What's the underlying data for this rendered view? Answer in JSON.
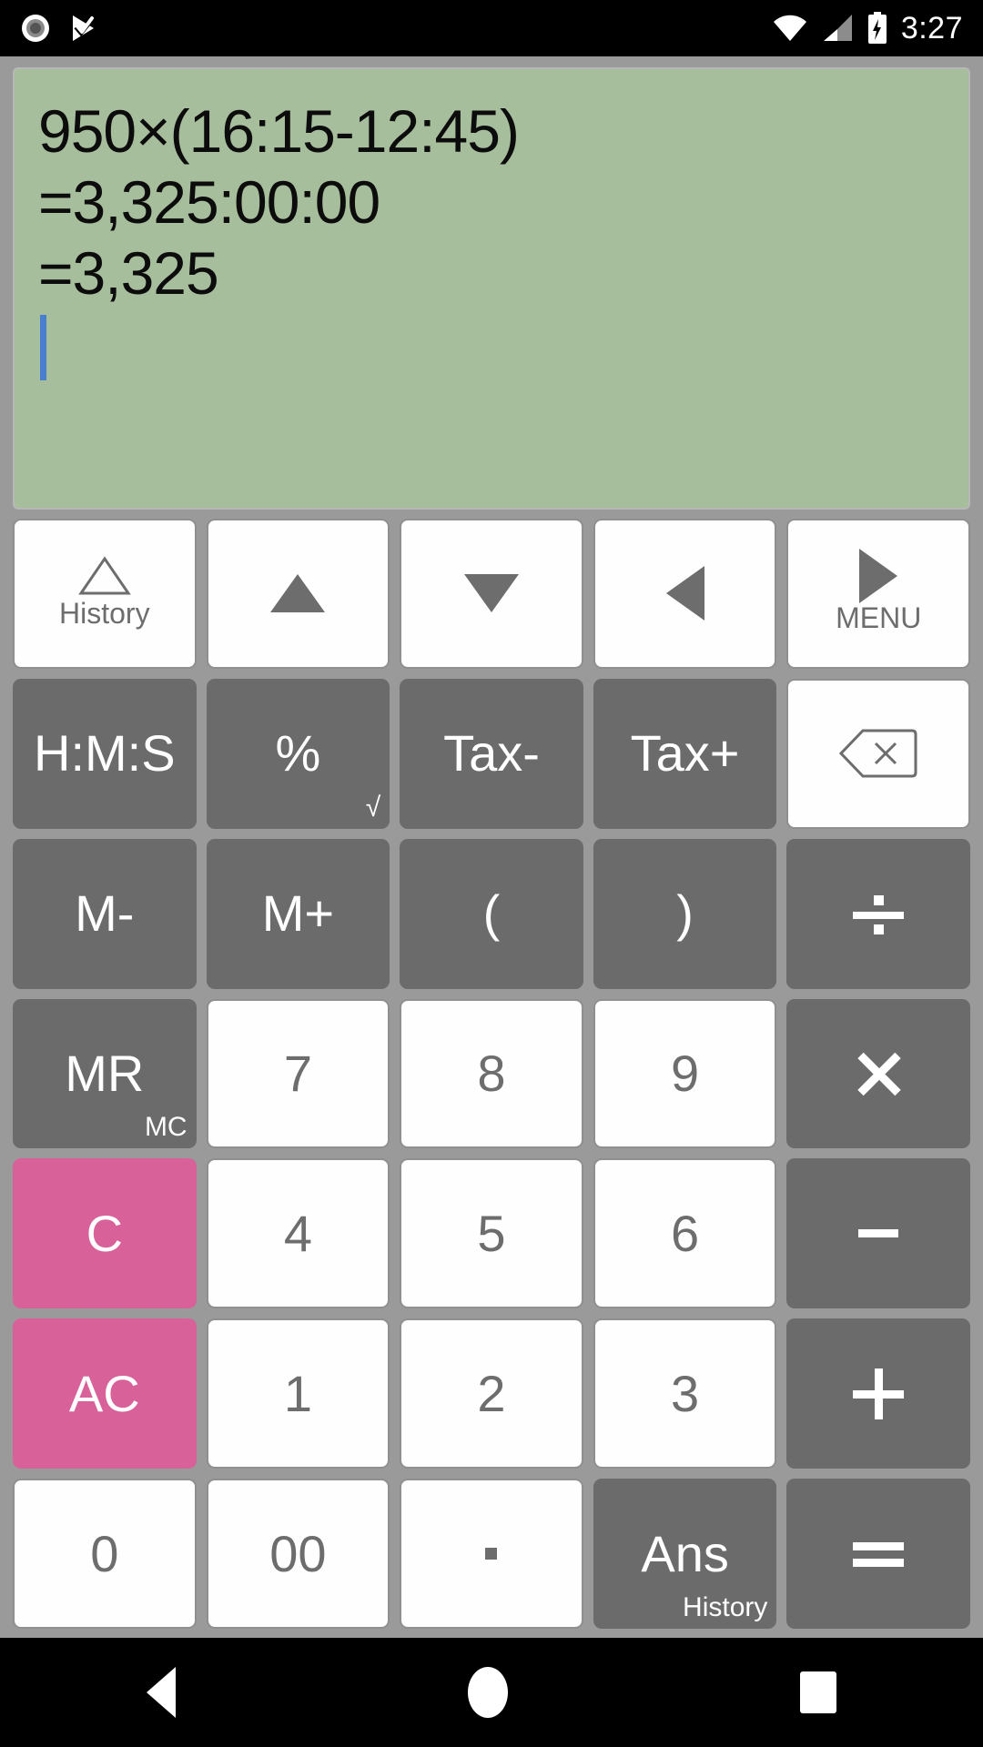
{
  "status_bar": {
    "left_icons": [
      "screen-record-icon",
      "play-check-icon"
    ],
    "right_icons": [
      "wifi-icon",
      "cellular-signal-icon",
      "battery-charging-icon"
    ],
    "time": "3:27"
  },
  "display": {
    "lines": [
      "950×(16:15-12:45)",
      "=3,325:00:00",
      "=3,325"
    ],
    "cursor_visible": true,
    "background_color": "#a7be9d",
    "text_color": "#0c0c0c",
    "cursor_color": "#4a7fd0"
  },
  "colors": {
    "white_key": "#fefefe",
    "gray_key": "#6b6b6b",
    "pink_key": "#d9619a",
    "panel": "#9a9a9a",
    "key_text_dark": "#6d6d6d",
    "key_text_light": "#ffffff"
  },
  "keypad": {
    "row1": [
      {
        "name": "history-key",
        "icon": "triangle-outline-icon",
        "sub": "History"
      },
      {
        "name": "arrow-up-key",
        "icon": "triangle-up-icon"
      },
      {
        "name": "arrow-down-key",
        "icon": "triangle-down-icon"
      },
      {
        "name": "arrow-left-key",
        "icon": "triangle-left-icon"
      },
      {
        "name": "menu-key",
        "icon": "triangle-right-icon",
        "sub": "MENU"
      }
    ],
    "row2": [
      {
        "name": "hms-key",
        "label": "H:M:S"
      },
      {
        "name": "percent-key",
        "label": "%",
        "sub": "√"
      },
      {
        "name": "tax-minus-key",
        "label": "Tax-"
      },
      {
        "name": "tax-plus-key",
        "label": "Tax+"
      },
      {
        "name": "backspace-key",
        "icon": "backspace-icon"
      }
    ],
    "row3": [
      {
        "name": "memory-minus-key",
        "label": "M-"
      },
      {
        "name": "memory-plus-key",
        "label": "M+"
      },
      {
        "name": "paren-open-key",
        "label": "("
      },
      {
        "name": "paren-close-key",
        "label": ")"
      },
      {
        "name": "divide-key",
        "label": "÷"
      }
    ],
    "row4": [
      {
        "name": "memory-recall-key",
        "label": "MR",
        "sub": "MC"
      },
      {
        "name": "digit-7-key",
        "label": "7"
      },
      {
        "name": "digit-8-key",
        "label": "8"
      },
      {
        "name": "digit-9-key",
        "label": "9"
      },
      {
        "name": "multiply-key",
        "label": "×"
      }
    ],
    "row5": [
      {
        "name": "clear-key",
        "label": "C"
      },
      {
        "name": "digit-4-key",
        "label": "4"
      },
      {
        "name": "digit-5-key",
        "label": "5"
      },
      {
        "name": "digit-6-key",
        "label": "6"
      },
      {
        "name": "subtract-key",
        "label": "-"
      }
    ],
    "row6": [
      {
        "name": "all-clear-key",
        "label": "AC"
      },
      {
        "name": "digit-1-key",
        "label": "1"
      },
      {
        "name": "digit-2-key",
        "label": "2"
      },
      {
        "name": "digit-3-key",
        "label": "3"
      },
      {
        "name": "add-key",
        "label": "+"
      }
    ],
    "row7": [
      {
        "name": "digit-0-key",
        "label": "0"
      },
      {
        "name": "digit-00-key",
        "label": "00"
      },
      {
        "name": "decimal-point-key",
        "label": "·"
      },
      {
        "name": "answer-key",
        "label": "Ans",
        "sub": "History"
      },
      {
        "name": "equals-key",
        "label": "="
      }
    ]
  },
  "nav_bar": {
    "back": "back-icon",
    "home": "home-icon",
    "recents": "recents-icon"
  }
}
